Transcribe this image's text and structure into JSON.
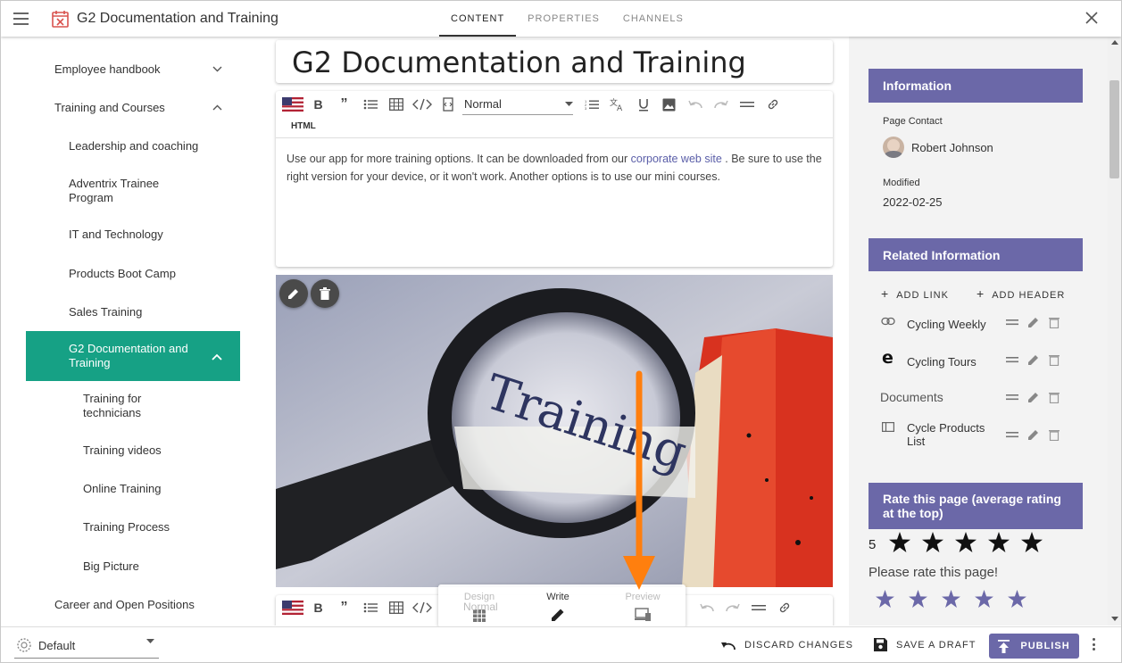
{
  "header": {
    "app_title": "G2 Documentation and Training",
    "tabs": [
      "CONTENT",
      "PROPERTIES",
      "CHANNELS"
    ],
    "active_tab": "CONTENT"
  },
  "nav": {
    "items": [
      {
        "label": "Employee handbook",
        "level": 1,
        "expanded": false
      },
      {
        "label": "Training and Courses",
        "level": 1,
        "expanded": true
      },
      {
        "label": "Leadership and coaching",
        "level": 2
      },
      {
        "label": "Adventrix Trainee Program",
        "level": 2
      },
      {
        "label": "IT and Technology",
        "level": 2
      },
      {
        "label": "Products Boot Camp",
        "level": 2
      },
      {
        "label": "Sales Training",
        "level": 2
      },
      {
        "label": "G2 Documentation and Training",
        "level": 2,
        "active": true
      },
      {
        "label": "Training for technicians",
        "level": 3
      },
      {
        "label": "Training videos",
        "level": 3
      },
      {
        "label": "Online Training",
        "level": 3
      },
      {
        "label": "Training Process",
        "level": 3
      },
      {
        "label": "Big Picture",
        "level": 3
      },
      {
        "label": "Career and Open Positions",
        "level": 1
      }
    ]
  },
  "editor": {
    "page_title": "G2 Documentation and Training",
    "style_value": "Normal",
    "html_label": "HTML",
    "body_text_before": "Use our app for more training options. It can be downloaded from our ",
    "body_link": "corporate web site",
    "body_text_after": " . Be sure to use the right version for your device, or it won't work. Another options is to use our mini courses.",
    "image_word": "Training"
  },
  "mode_popup": {
    "modes": [
      "Design",
      "Write",
      "Preview"
    ],
    "style_ghost": "Normal"
  },
  "right_panel": {
    "info_header": "Information",
    "page_contact_label": "Page Contact",
    "page_contact_name": "Robert Johnson",
    "modified_label": "Modified",
    "modified_value": "2022-02-25",
    "related_header": "Related Information",
    "add_link": "ADD LINK",
    "add_header": "ADD HEADER",
    "related_items": [
      {
        "label": "Cycling Weekly",
        "icon": "link-icon"
      },
      {
        "label": "Cycling Tours",
        "icon": "edge-browser-icon"
      },
      {
        "label": "Documents",
        "icon": "none",
        "is_header": true
      },
      {
        "label": "Cycle Products List",
        "icon": "list-icon"
      }
    ],
    "rate_header": "Rate this page (average rating at the top)",
    "rating_average": "5",
    "rate_prompt": "Please rate this page!",
    "rating_stars": 5
  },
  "bottom": {
    "channel": "Default",
    "discard": "DISCARD CHANGES",
    "save_draft": "SAVE A DRAFT",
    "publish": "PUBLISH"
  },
  "colors": {
    "accent_purple": "#6b68a8",
    "nav_active_green": "#16a185",
    "annotation_arrow": "#ff7f0e"
  }
}
